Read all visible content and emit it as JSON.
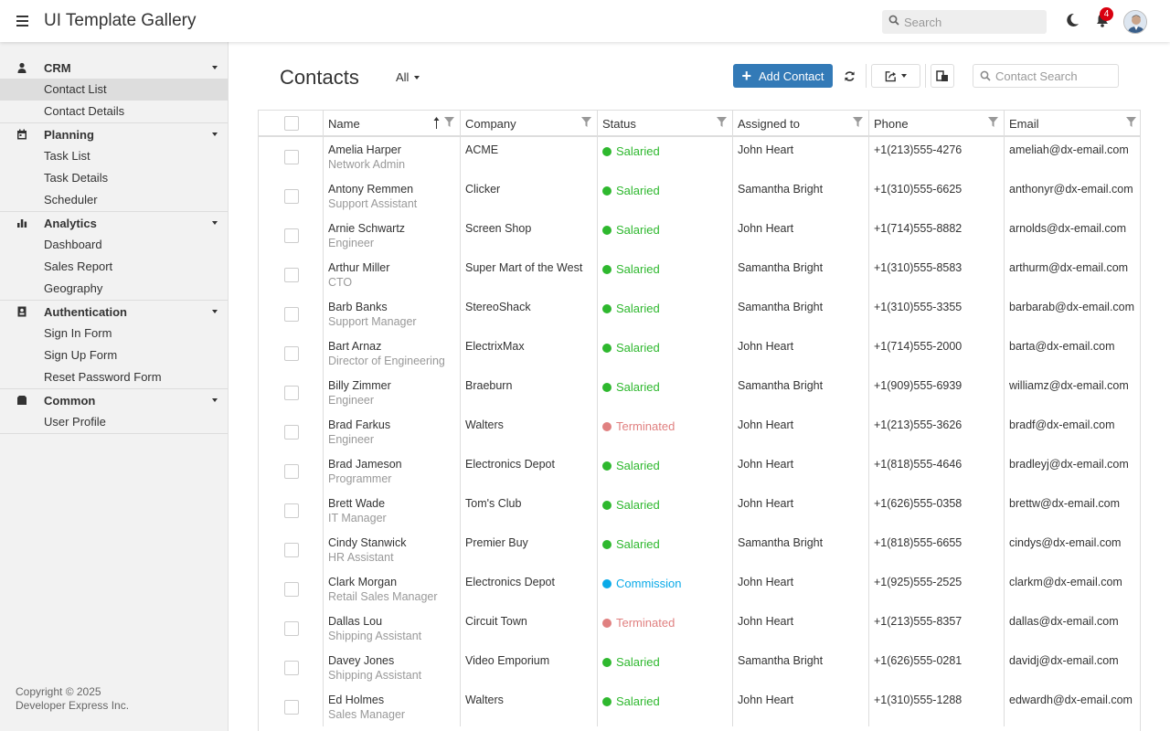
{
  "header": {
    "title": "UI Template Gallery",
    "search_placeholder": "Search",
    "notification_count": "4"
  },
  "sidebar": {
    "groups": [
      {
        "label": "CRM",
        "icon": "person-icon",
        "items": [
          {
            "label": "Contact List",
            "active": true
          },
          {
            "label": "Contact Details"
          }
        ]
      },
      {
        "label": "Planning",
        "icon": "calendar-icon",
        "items": [
          {
            "label": "Task List"
          },
          {
            "label": "Task Details"
          },
          {
            "label": "Scheduler"
          }
        ]
      },
      {
        "label": "Analytics",
        "icon": "chart-icon",
        "items": [
          {
            "label": "Dashboard"
          },
          {
            "label": "Sales Report"
          },
          {
            "label": "Geography"
          }
        ]
      },
      {
        "label": "Authentication",
        "icon": "id-card-icon",
        "items": [
          {
            "label": "Sign In Form"
          },
          {
            "label": "Sign Up Form"
          },
          {
            "label": "Reset Password Form"
          }
        ]
      },
      {
        "label": "Common",
        "icon": "folder-icon",
        "items": [
          {
            "label": "User Profile"
          }
        ]
      }
    ],
    "copyright_line1": "Copyright © 2025",
    "copyright_line2": "Developer Express Inc."
  },
  "main": {
    "title": "Contacts",
    "filter_value": "All",
    "add_button_label": "Add Contact",
    "search_placeholder": "Contact Search"
  },
  "grid": {
    "columns": [
      "Name",
      "Company",
      "Status",
      "Assigned to",
      "Phone",
      "Email"
    ],
    "status_colors": {
      "Salaried": "#2eb82e",
      "Terminated": "#e08080",
      "Commission": "#0aaae8"
    },
    "rows": [
      {
        "name": "Amelia Harper",
        "position": "Network Admin",
        "company": "ACME",
        "status": "Salaried",
        "assigned": "John Heart",
        "phone": "+1(213)555-4276",
        "email": "ameliah@dx-email.com"
      },
      {
        "name": "Antony Remmen",
        "position": "Support Assistant",
        "company": "Clicker",
        "status": "Salaried",
        "assigned": "Samantha Bright",
        "phone": "+1(310)555-6625",
        "email": "anthonyr@dx-email.com"
      },
      {
        "name": "Arnie Schwartz",
        "position": "Engineer",
        "company": "Screen Shop",
        "status": "Salaried",
        "assigned": "John Heart",
        "phone": "+1(714)555-8882",
        "email": "arnolds@dx-email.com"
      },
      {
        "name": "Arthur Miller",
        "position": "CTO",
        "company": "Super Mart of the West",
        "status": "Salaried",
        "assigned": "Samantha Bright",
        "phone": "+1(310)555-8583",
        "email": "arthurm@dx-email.com"
      },
      {
        "name": "Barb Banks",
        "position": "Support Manager",
        "company": "StereoShack",
        "status": "Salaried",
        "assigned": "Samantha Bright",
        "phone": "+1(310)555-3355",
        "email": "barbarab@dx-email.com"
      },
      {
        "name": "Bart Arnaz",
        "position": "Director of Engineering",
        "company": "ElectrixMax",
        "status": "Salaried",
        "assigned": "John Heart",
        "phone": "+1(714)555-2000",
        "email": "barta@dx-email.com"
      },
      {
        "name": "Billy Zimmer",
        "position": "Engineer",
        "company": "Braeburn",
        "status": "Salaried",
        "assigned": "Samantha Bright",
        "phone": "+1(909)555-6939",
        "email": "williamz@dx-email.com"
      },
      {
        "name": "Brad Farkus",
        "position": "Engineer",
        "company": "Walters",
        "status": "Terminated",
        "assigned": "John Heart",
        "phone": "+1(213)555-3626",
        "email": "bradf@dx-email.com"
      },
      {
        "name": "Brad Jameson",
        "position": "Programmer",
        "company": "Electronics Depot",
        "status": "Salaried",
        "assigned": "John Heart",
        "phone": "+1(818)555-4646",
        "email": "bradleyj@dx-email.com"
      },
      {
        "name": "Brett Wade",
        "position": "IT Manager",
        "company": "Tom's Club",
        "status": "Salaried",
        "assigned": "John Heart",
        "phone": "+1(626)555-0358",
        "email": "brettw@dx-email.com"
      },
      {
        "name": "Cindy Stanwick",
        "position": "HR Assistant",
        "company": "Premier Buy",
        "status": "Salaried",
        "assigned": "Samantha Bright",
        "phone": "+1(818)555-6655",
        "email": "cindys@dx-email.com"
      },
      {
        "name": "Clark Morgan",
        "position": "Retail Sales Manager",
        "company": "Electronics Depot",
        "status": "Commission",
        "assigned": "John Heart",
        "phone": "+1(925)555-2525",
        "email": "clarkm@dx-email.com"
      },
      {
        "name": "Dallas Lou",
        "position": "Shipping Assistant",
        "company": "Circuit Town",
        "status": "Terminated",
        "assigned": "John Heart",
        "phone": "+1(213)555-8357",
        "email": "dallas@dx-email.com"
      },
      {
        "name": "Davey Jones",
        "position": "Shipping Assistant",
        "company": "Video Emporium",
        "status": "Salaried",
        "assigned": "Samantha Bright",
        "phone": "+1(626)555-0281",
        "email": "davidj@dx-email.com"
      },
      {
        "name": "Ed Holmes",
        "position": "Sales Manager",
        "company": "Walters",
        "status": "Salaried",
        "assigned": "John Heart",
        "phone": "+1(310)555-1288",
        "email": "edwardh@dx-email.com"
      }
    ]
  }
}
